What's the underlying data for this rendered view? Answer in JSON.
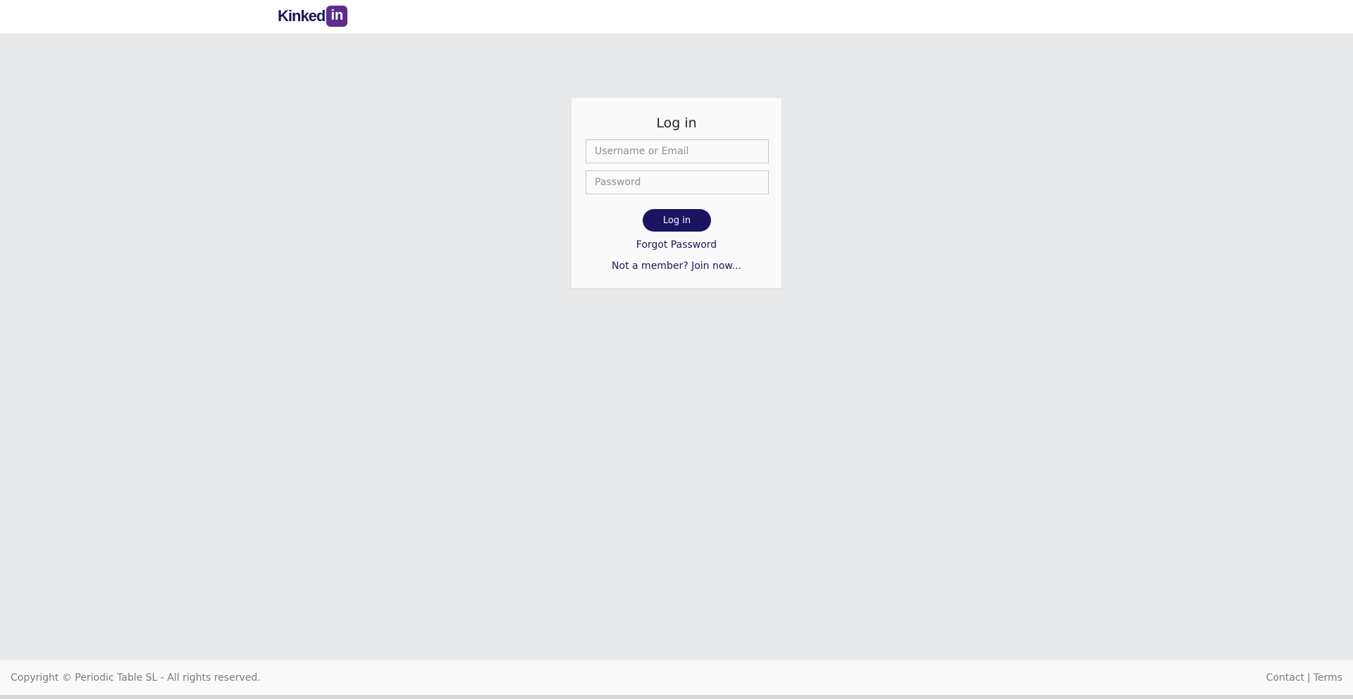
{
  "header": {
    "logo_text": "Kinked",
    "logo_badge": "in"
  },
  "login": {
    "title": "Log in",
    "username_placeholder": "Username or Email",
    "password_placeholder": "Password",
    "submit_label": "Log in",
    "forgot_label": "Forgot Password",
    "join_label": "Not a member? Join now..."
  },
  "footer": {
    "copyright": "Copyright © Periodic Table SL - All rights reserved.",
    "contact_label": "Contact",
    "separator": "|",
    "terms_label": "Terms"
  },
  "colors": {
    "brand_navy": "#1b1462",
    "logo_purple": "#5b2d8c",
    "page_background": "#e8e9eb"
  }
}
